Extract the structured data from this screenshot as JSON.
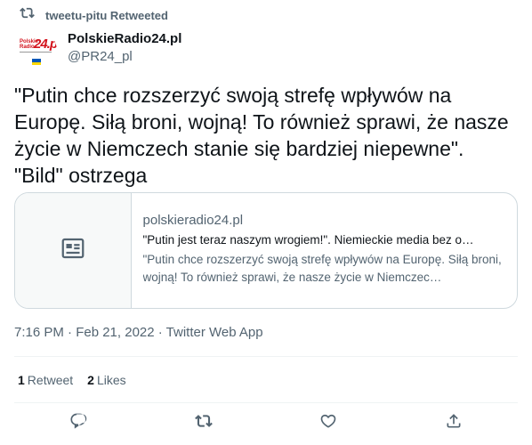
{
  "retweet": {
    "text": "tweetu-pitu Retweeted",
    "icon": "retweet-icon"
  },
  "author": {
    "display_name": "PolskieRadio24.pl",
    "handle": "@PR24_pl",
    "avatar": {
      "logo_small": "Polskie Radio",
      "logo_big": "24.pl"
    }
  },
  "tweet": {
    "text": "\"Putin chce rozszerzyć swoją strefę wpływów na Europę. Siłą broni, wojną! To również sprawi, że nasze życie w Niemczech stanie się bardziej niepewne\". \"Bild\" ostrzega"
  },
  "card": {
    "domain": "polskieradio24.pl",
    "title": "\"Putin jest teraz naszym wrogiem!\". Niemieckie media bez o…",
    "description": "\"Putin chce rozszerzyć swoją strefę wpływów na Europę. Siłą broni, wojną! To również sprawi, że nasze życie w Niemczec…",
    "media_icon": "article-icon"
  },
  "meta": {
    "timestamp": "7:16 PM · Feb 21, 2022 · Twitter Web App"
  },
  "stats": {
    "retweets_count": "1",
    "retweets_label": "Retweet",
    "likes_count": "2",
    "likes_label": "Likes"
  },
  "actions": [
    {
      "name": "reply",
      "icon": "reply-icon"
    },
    {
      "name": "retweet",
      "icon": "retweet-icon"
    },
    {
      "name": "like",
      "icon": "heart-icon"
    },
    {
      "name": "share",
      "icon": "share-icon"
    }
  ],
  "colors": {
    "text": "#0f1419",
    "secondary": "#536471",
    "border": "#cfd9de",
    "brand_red": "#d3131c"
  }
}
